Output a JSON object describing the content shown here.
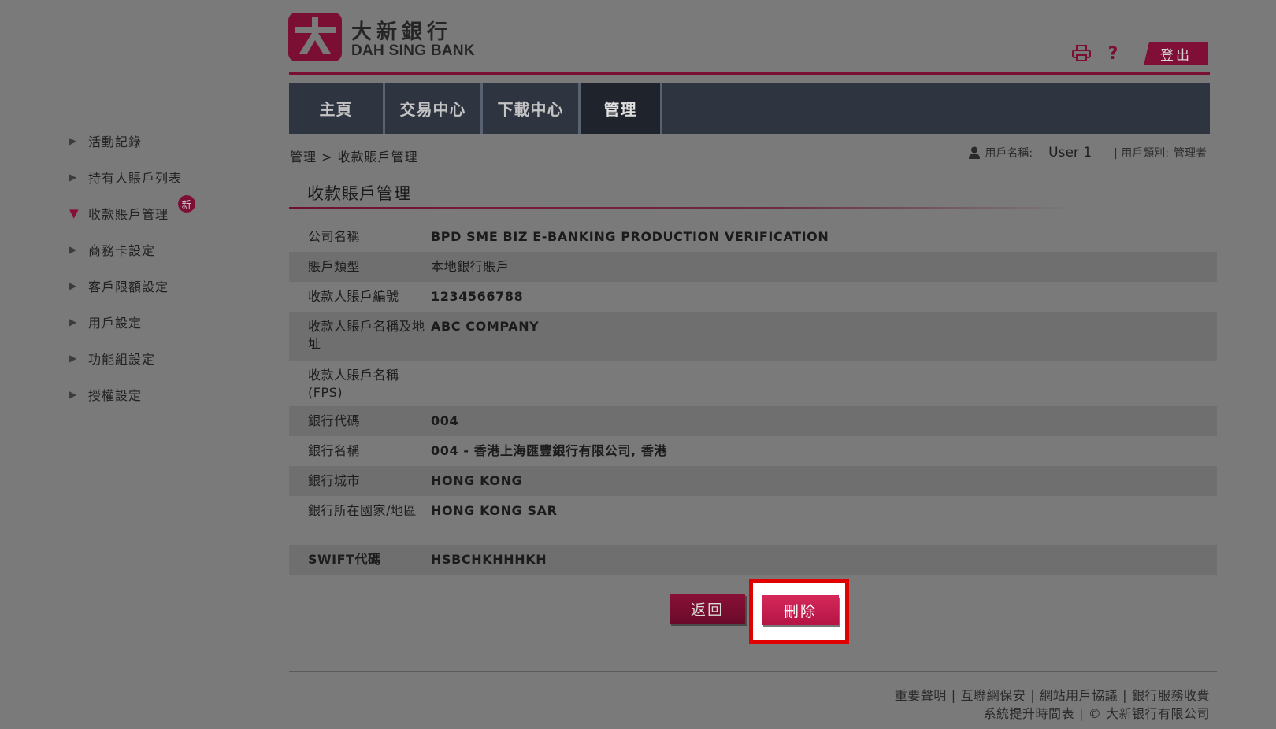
{
  "brand": {
    "name_cn": "大新銀行",
    "name_en": "DAH SING BANK",
    "color": "#7a0f33"
  },
  "header": {
    "print_icon": "printer-icon",
    "help_icon": "question-mark-icon",
    "logout_label": "登出"
  },
  "nav": {
    "tabs": [
      {
        "label": "主頁",
        "active": false
      },
      {
        "label": "交易中心",
        "active": false
      },
      {
        "label": "下載中心",
        "active": false
      },
      {
        "label": "管理",
        "active": true
      }
    ]
  },
  "sidebar": {
    "items": [
      {
        "label": "活動記錄",
        "expanded": false
      },
      {
        "label": "持有人賬戶列表",
        "expanded": false
      },
      {
        "label": "收款賬戶管理",
        "expanded": true,
        "badge": "新"
      },
      {
        "label": "商務卡設定",
        "expanded": false
      },
      {
        "label": "客戶限額設定",
        "expanded": false
      },
      {
        "label": "用戶設定",
        "expanded": false
      },
      {
        "label": "功能組設定",
        "expanded": false
      },
      {
        "label": "授權設定",
        "expanded": false
      }
    ]
  },
  "breadcrumb": {
    "text": "管理 > 收款賬戶管理"
  },
  "user": {
    "name_label": "用戶名稱:",
    "name": "User 1",
    "type_label": "| 用戶類別:",
    "type": "管理者"
  },
  "page": {
    "title": "收款賬戶管理"
  },
  "details": [
    {
      "label": "公司名稱",
      "value": "BPD SME BIZ E-BANKING PRODUCTION VERIFICATION"
    },
    {
      "label": "賬戶類型",
      "value": "本地銀行賬戶"
    },
    {
      "label": "收款人賬戶編號",
      "value": "1234566788"
    },
    {
      "label": "收款人賬戶名稱及地址",
      "value": "ABC COMPANY"
    },
    {
      "label": "收款人賬戶名稱(FPS)",
      "value": ""
    },
    {
      "label": "銀行代碼",
      "value": "004"
    },
    {
      "label": "銀行名稱",
      "value": "004 - 香港上海匯豐銀行有限公司, 香港"
    },
    {
      "label": "銀行城市",
      "value": "HONG KONG"
    },
    {
      "label": "銀行所在國家/地區",
      "value": "HONG KONG SAR"
    },
    {
      "label": "SWIFT代碼",
      "value": "HSBCHKHHHKH"
    }
  ],
  "actions": {
    "back_label": "返回",
    "delete_label": "刪除",
    "highlight_color": "#e00000"
  },
  "footer": {
    "links": [
      "重要聲明",
      "互聯網保安",
      "網站用戶協議",
      "銀行服務收費"
    ],
    "upgrade_link": "系統提升時間表",
    "copyright": "© 大新银行有限公司"
  }
}
